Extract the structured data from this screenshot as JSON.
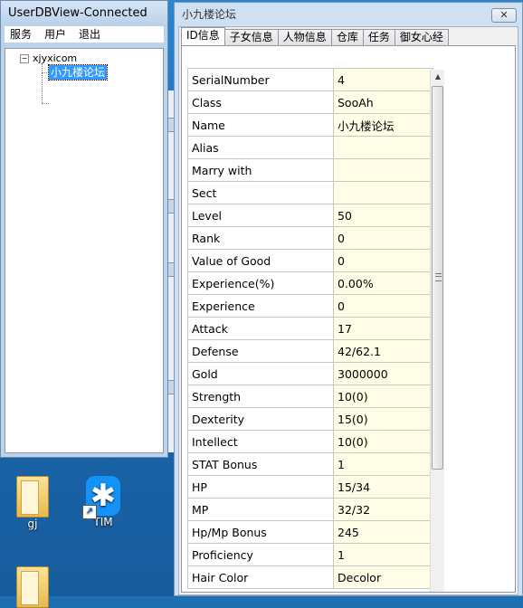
{
  "left_window": {
    "title": "UserDBView-Connected",
    "menu": [
      "服务",
      "用户",
      "退出"
    ],
    "tree": {
      "root": "xjyxicom",
      "child": "小九楼论坛"
    }
  },
  "right_window": {
    "title": "小九楼论坛",
    "close_label": "✕",
    "tabs": [
      "ID信息",
      "子女信息",
      "人物信息",
      "仓库",
      "任务",
      "御女心经"
    ],
    "active_tab": 0,
    "properties": [
      {
        "key": "SerialNumber",
        "value": "4"
      },
      {
        "key": "Class",
        "value": "SooAh"
      },
      {
        "key": "Name",
        "value": "小九楼论坛"
      },
      {
        "key": "Alias",
        "value": ""
      },
      {
        "key": "Marry with",
        "value": ""
      },
      {
        "key": "Sect",
        "value": ""
      },
      {
        "key": "Level",
        "value": "50"
      },
      {
        "key": "Rank",
        "value": "0"
      },
      {
        "key": "Value of Good",
        "value": "0"
      },
      {
        "key": "Experience(%)",
        "value": "0.00%"
      },
      {
        "key": "Experience",
        "value": "0"
      },
      {
        "key": "Attack",
        "value": "17"
      },
      {
        "key": "Defense",
        "value": "42/62.1"
      },
      {
        "key": "Gold",
        "value": "3000000"
      },
      {
        "key": "Strength",
        "value": "10(0)"
      },
      {
        "key": "Dexterity",
        "value": "15(0)"
      },
      {
        "key": "Intellect",
        "value": "10(0)"
      },
      {
        "key": "STAT Bonus",
        "value": "1"
      },
      {
        "key": "HP",
        "value": "15/34"
      },
      {
        "key": "MP",
        "value": "32/32"
      },
      {
        "key": "Hp/Mp Bonus",
        "value": "245"
      },
      {
        "key": "Proficiency",
        "value": "1"
      },
      {
        "key": "Hair Color",
        "value": "Decolor"
      }
    ]
  },
  "desktop": {
    "icons": [
      {
        "label": "gj",
        "icon": "folder-icon"
      },
      {
        "label": "TIM",
        "icon": "tim-app-icon"
      },
      {
        "label": "",
        "icon": "folder-icon"
      }
    ]
  }
}
